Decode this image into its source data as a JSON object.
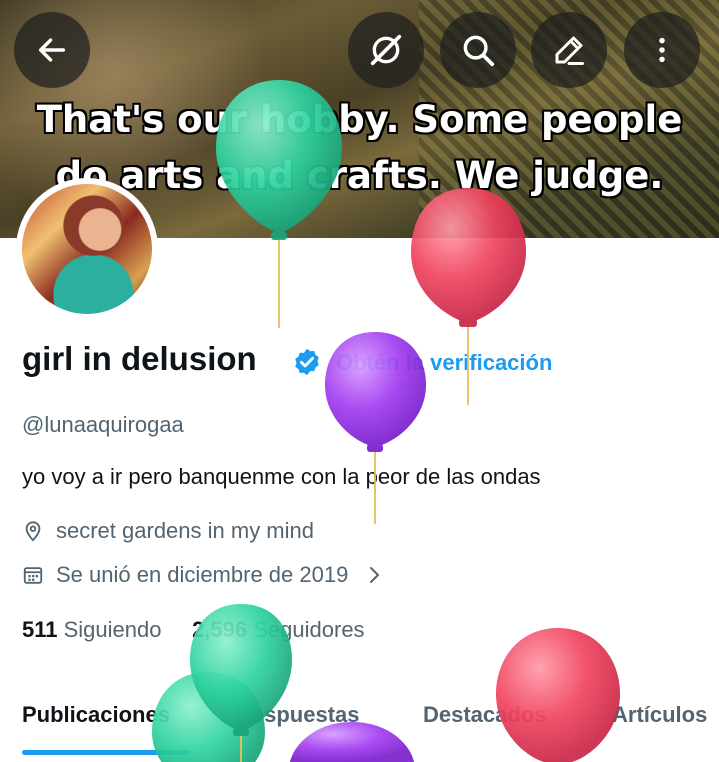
{
  "banner": {
    "line1": "That's our hobby. Some people",
    "line2": "do arts and crafts. We judge."
  },
  "topbar": {
    "back_icon": "arrow-left-icon",
    "grok_icon": "grok-icon",
    "search_icon": "search-icon",
    "edit_icon": "pencil-icon",
    "more_icon": "more-vertical-icon"
  },
  "profile": {
    "name": "girl in delusion",
    "get_verified": "Obtén la verificación",
    "handle": "@lunaaquirogaa",
    "bio": "yo voy a ir pero banquenme con la peor de las ondas",
    "location": "secret gardens in my mind",
    "joined": "Se unió en diciembre de 2019",
    "following_count": "511",
    "following_label": "Siguiendo",
    "followers_count": "2,596",
    "followers_label": "Seguidores"
  },
  "tabs": [
    {
      "label": "Publicaciones"
    },
    {
      "label": "Respuestas"
    },
    {
      "label": "Destacados"
    },
    {
      "label": "Artículos"
    }
  ],
  "colors": {
    "accent": "#1d9bf0",
    "balloon_green": "#2ed3a0",
    "balloon_pink": "#f0435e",
    "balloon_purple": "#a23cf0"
  }
}
